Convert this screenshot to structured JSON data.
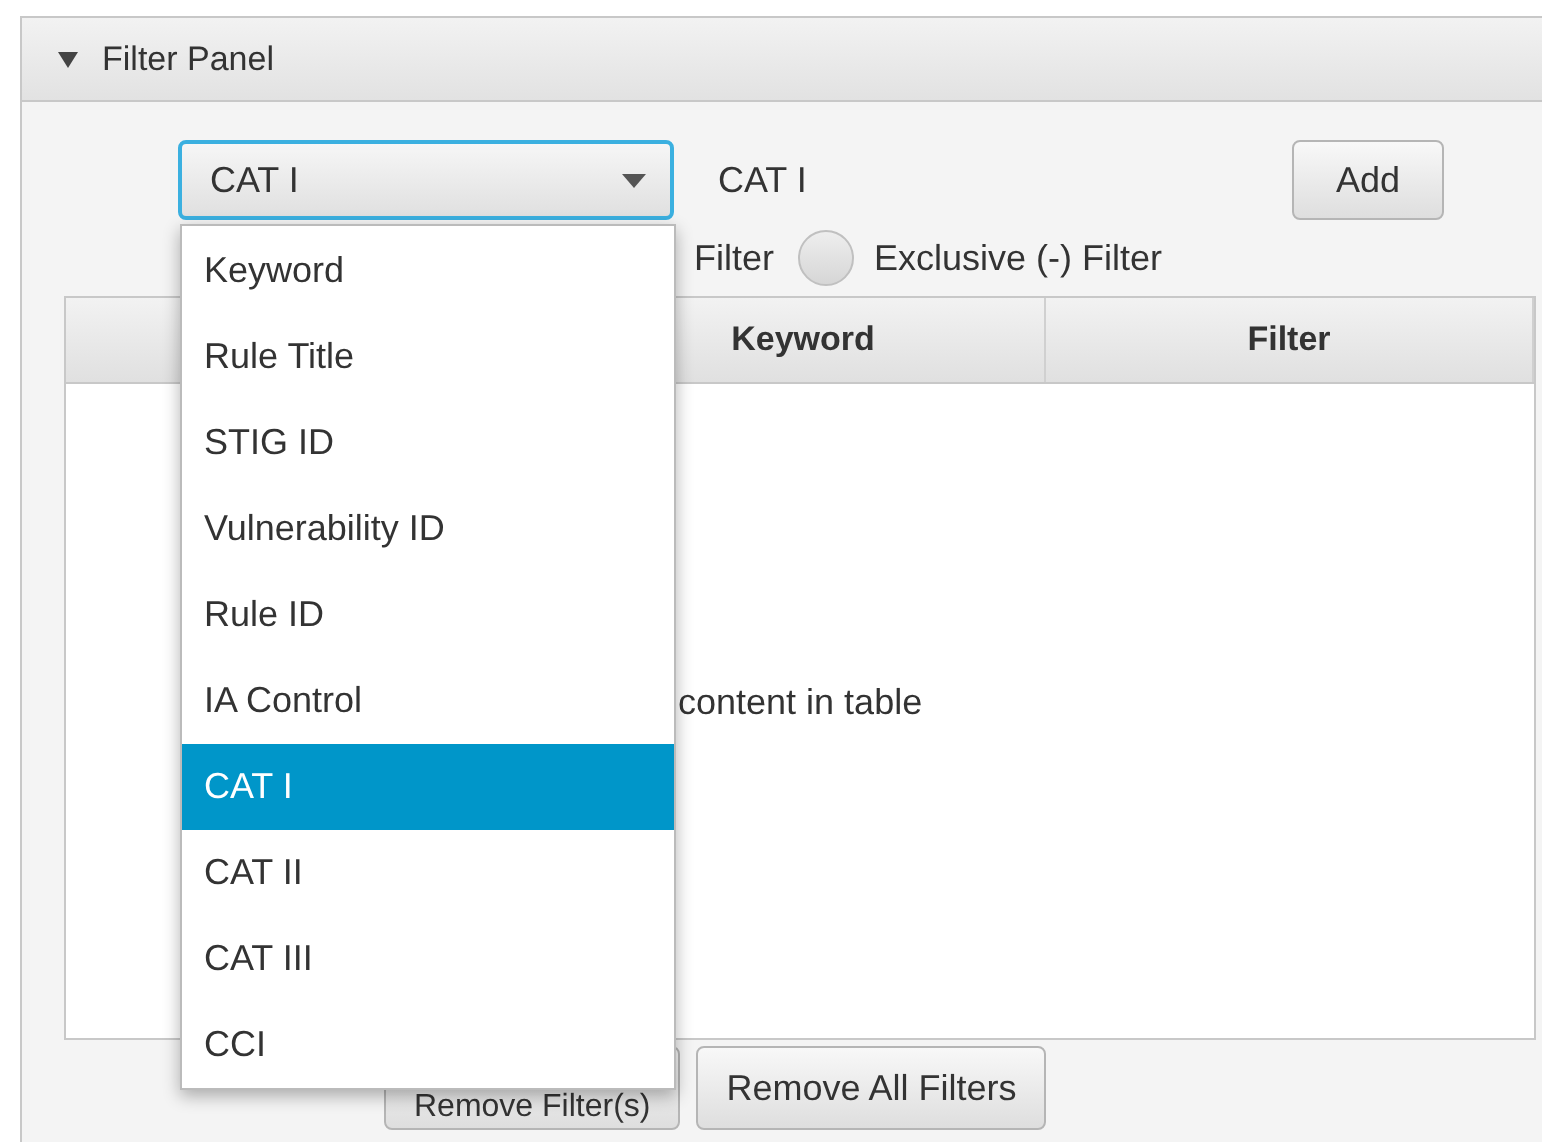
{
  "panel": {
    "title": "Filter Panel",
    "expanded": true
  },
  "combo": {
    "value": "CAT I",
    "open": true,
    "options": [
      {
        "label": "Keyword",
        "selected": false
      },
      {
        "label": "Rule Title",
        "selected": false
      },
      {
        "label": "STIG ID",
        "selected": false
      },
      {
        "label": "Vulnerability ID",
        "selected": false
      },
      {
        "label": "Rule ID",
        "selected": false
      },
      {
        "label": "IA Control",
        "selected": false
      },
      {
        "label": "CAT I",
        "selected": true
      },
      {
        "label": "CAT II",
        "selected": false
      },
      {
        "label": "CAT III",
        "selected": false
      },
      {
        "label": "CCI",
        "selected": false
      }
    ]
  },
  "keyword_label": "CAT I",
  "add_button": "Add",
  "radios": [
    {
      "label": "Filter"
    },
    {
      "label": "Exclusive (-) Filter",
      "selected": false
    }
  ],
  "table": {
    "columns": [
      "Keyword",
      "Filter"
    ],
    "placeholder": "content in table"
  },
  "buttons": [
    "Remove Filter(s)",
    "Remove All Filters"
  ]
}
